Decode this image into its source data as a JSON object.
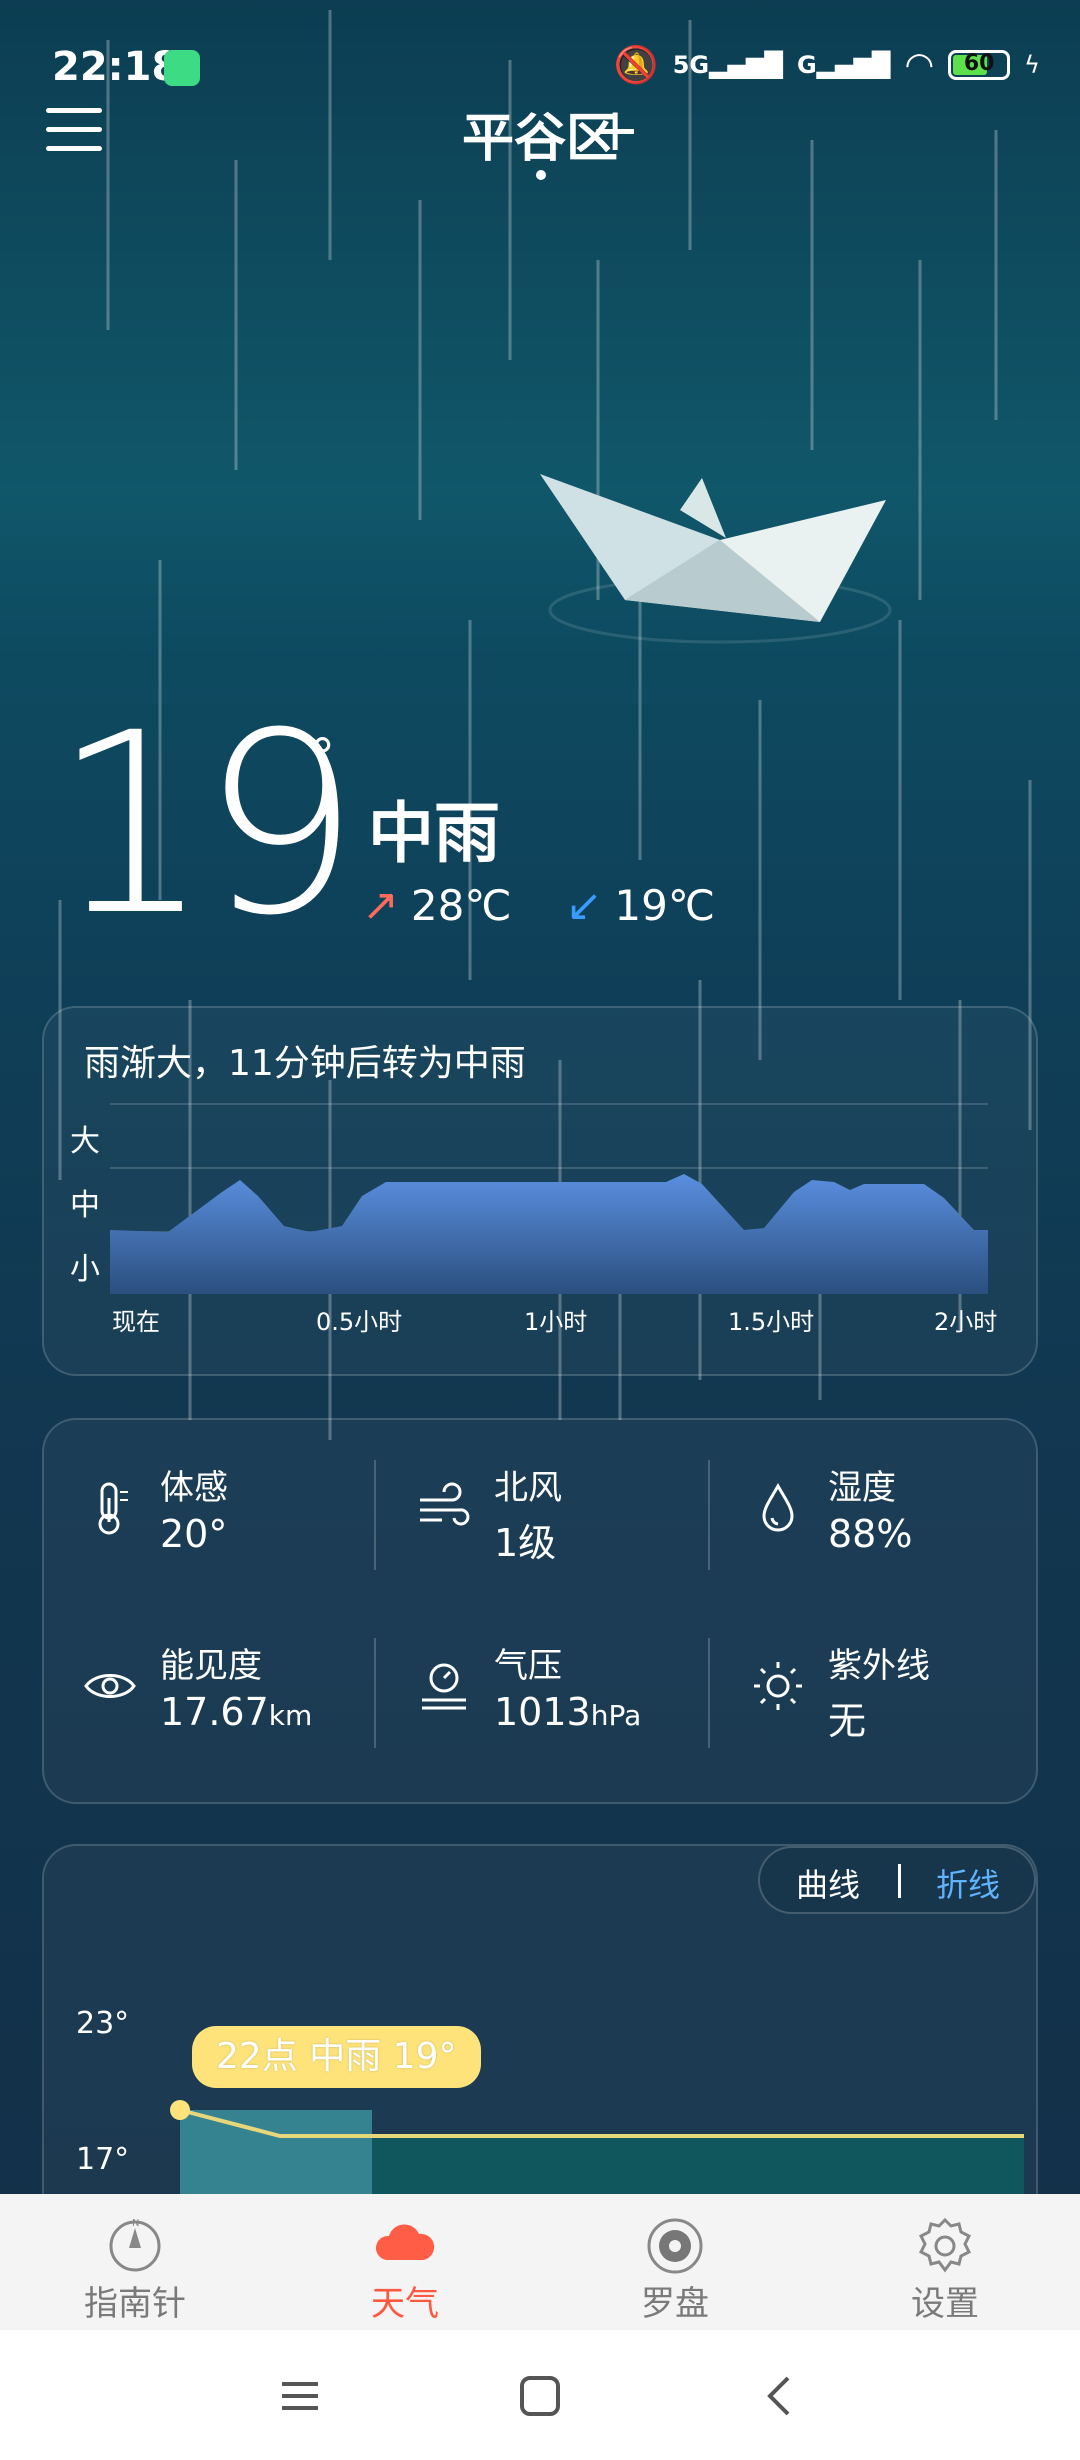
{
  "status_bar": {
    "time": "22:18",
    "network": "5G",
    "network2": "G",
    "battery": "60"
  },
  "header": {
    "city": "平谷区",
    "add": "+"
  },
  "current": {
    "temp": "19",
    "degree": "°",
    "condition": "中雨",
    "high": "28℃",
    "low": "19℃"
  },
  "rain": {
    "summary": "雨渐大，11分钟后转为中雨",
    "levels": [
      "大",
      "中",
      "小"
    ],
    "ticks": [
      "现在",
      "0.5小时",
      "1小时",
      "1.5小时",
      "2小时"
    ]
  },
  "details": [
    {
      "label": "体感",
      "value": "20°",
      "unit": "",
      "icon": "thermometer-icon"
    },
    {
      "label": "北风",
      "value": "1级",
      "unit": "",
      "icon": "wind-icon"
    },
    {
      "label": "湿度",
      "value": "88%",
      "unit": "",
      "icon": "drop-icon"
    },
    {
      "label": "能见度",
      "value": "17.67",
      "unit": "km",
      "icon": "eye-icon"
    },
    {
      "label": "气压",
      "value": "1013",
      "unit": "hPa",
      "icon": "pressure-icon"
    },
    {
      "label": "紫外线",
      "value": "无",
      "unit": "",
      "icon": "sun-icon"
    }
  ],
  "hourly": {
    "toggle_curve": "曲线",
    "toggle_line": "折线",
    "y_max": "23°",
    "y_min": "17°",
    "tooltip": "22点 中雨 19°"
  },
  "nav": [
    {
      "label": "指南针",
      "icon": "compass-icon"
    },
    {
      "label": "天气",
      "icon": "cloud-icon"
    },
    {
      "label": "罗盘",
      "icon": "feng-shui-compass-icon"
    },
    {
      "label": "设置",
      "icon": "gear-icon"
    }
  ],
  "colors": {
    "accent": "#ff5840",
    "rain_fill": "#4a7fd0",
    "tooltip": "#fde37a",
    "toggle_active": "#5fb3ff"
  }
}
